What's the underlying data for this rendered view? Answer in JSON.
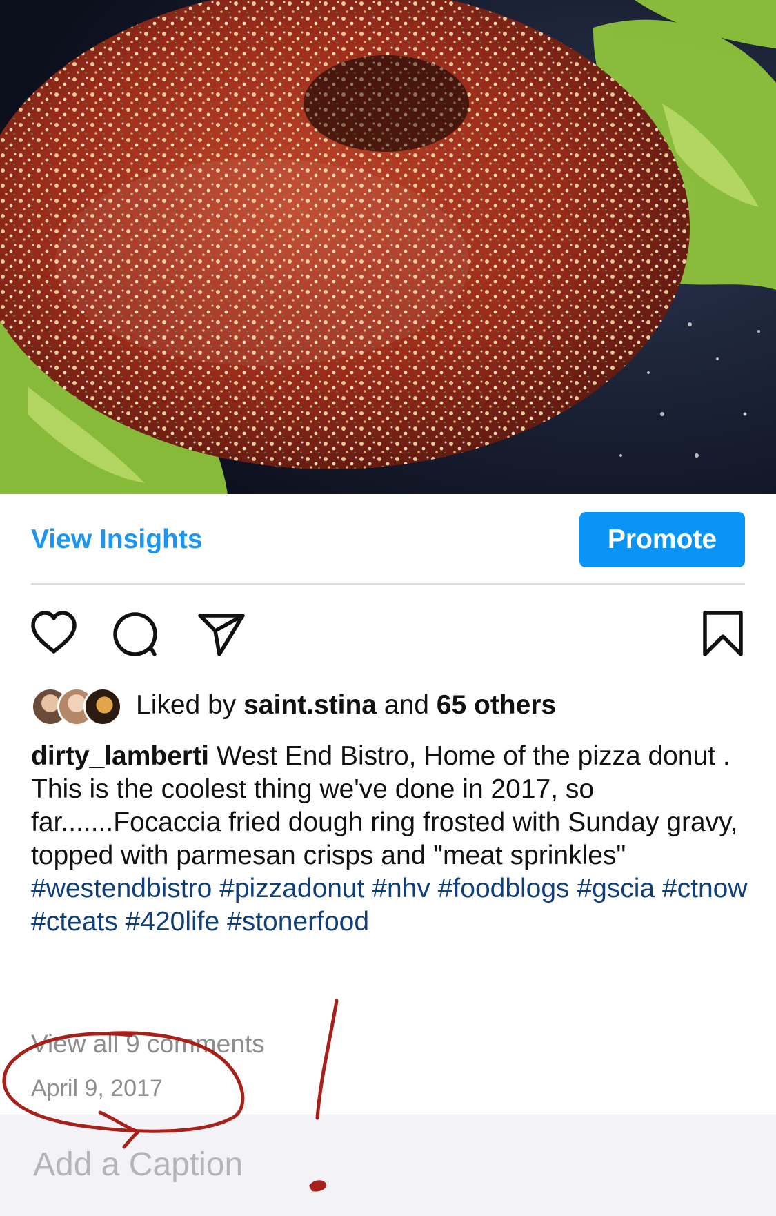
{
  "post": {
    "insights_label": "View Insights",
    "promote_label": "Promote",
    "liked_by_prefix": "Liked by",
    "liked_by_user": "saint.stina",
    "liked_by_and": "and",
    "liked_by_others": "65 others",
    "username": "dirty_lamberti",
    "caption_line1": "West End Bistro, Home of the pizza donut .",
    "caption_body": "This is the coolest thing we've done in 2017, so far.......Focaccia fried dough ring frosted with Sunday gravy, topped with parmesan crisps and \"meat sprinkles\"",
    "hashtags": "#westendbistro #pizzadonut #nhv #foodblogs #gscia #ctnow #cteats #420life #stonerfood",
    "view_comments": "View all 9 comments",
    "date": "April 9, 2017"
  },
  "caption_bar": {
    "placeholder": "Add a Caption"
  },
  "icons": [
    "heart-icon",
    "comment-icon",
    "share-icon",
    "bookmark-icon"
  ],
  "colors": {
    "accent": "#0a95f6",
    "link": "#1a95f2",
    "hashtag": "#0f3f7b",
    "annotation": "#a8201a"
  }
}
